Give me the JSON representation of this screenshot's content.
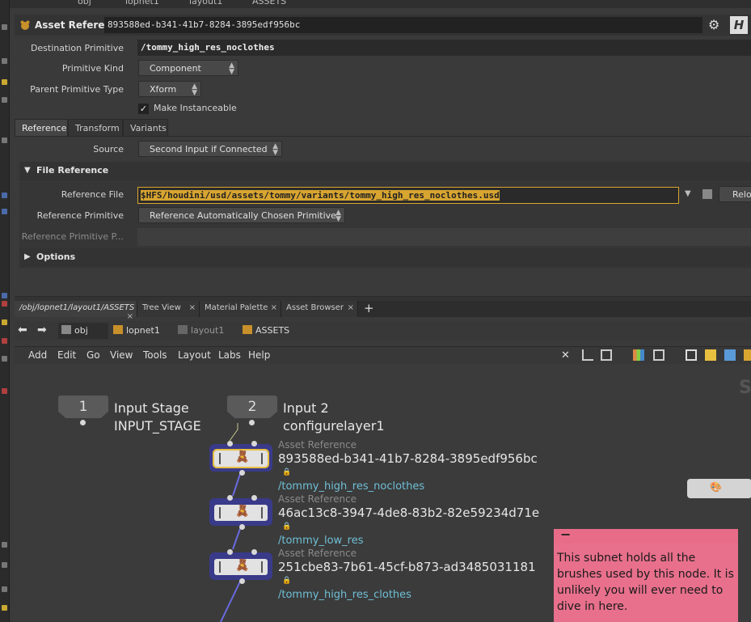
{
  "top_breadcrumb": [
    "obj",
    "lopnet1",
    "layout1",
    "ASSETS"
  ],
  "header": {
    "type_label": "Asset Reference",
    "node_name": "893588ed-b341-41b7-8284-3895edf956bc",
    "help_label": "H"
  },
  "params": {
    "destination_primitive": {
      "label": "Destination Primitive",
      "value": "/tommy_high_res_noclothes"
    },
    "primitive_kind": {
      "label": "Primitive Kind",
      "value": "Component"
    },
    "parent_primitive_type": {
      "label": "Parent Primitive Type",
      "value": "Xform"
    },
    "make_instanceable": {
      "label": "Make Instanceable",
      "checked": true
    }
  },
  "tabs": [
    "Reference",
    "Transform",
    "Variants"
  ],
  "source": {
    "label": "Source",
    "value": "Second Input if Connected"
  },
  "file_reference": {
    "title": "File Reference",
    "reference_file": {
      "label": "Reference File",
      "value": "$HFS/houdini/usd/assets/tommy/variants/tommy_high_res_noclothes.usd",
      "reload": "Relo"
    },
    "reference_primitive": {
      "label": "Reference Primitive",
      "value": "Reference Automatically Chosen Primitive"
    },
    "reference_primitive_path": {
      "label": "Reference Primitive P..."
    }
  },
  "options": {
    "title": "Options"
  },
  "pane_tabs": [
    {
      "label": "/obj/lopnet1/layout1/ASSETS"
    },
    {
      "label": "Tree View"
    },
    {
      "label": "Material Palette"
    },
    {
      "label": "Asset Browser"
    }
  ],
  "nav_crumbs": [
    "obj",
    "lopnet1",
    "layout1",
    "ASSETS"
  ],
  "menu": [
    "Add",
    "Edit",
    "Go",
    "View",
    "Tools",
    "Layout",
    "Labs",
    "Help"
  ],
  "network": {
    "input1": {
      "number": "1",
      "name": "Input Stage",
      "sub": "INPUT_STAGE"
    },
    "input2": {
      "number": "2",
      "name": "Input 2",
      "sub": "configurelayer1"
    },
    "nodes": [
      {
        "type": "Asset Reference",
        "name": "893588ed-b341-41b7-8284-3895edf956bc",
        "path": "/tommy_high_res_noclothes"
      },
      {
        "type": "Asset Reference",
        "name": "46ac13c8-3947-4de8-83b2-82e59234d71e",
        "path": "/tommy_low_res"
      },
      {
        "type": "Asset Reference",
        "name": "251cbe83-7b61-45cf-b873-ad3485031181",
        "path": "/tommy_high_res_clothes"
      }
    ],
    "sticky_note": "This subnet holds all the brushes used by this node. It is unlikely you will ever need to dive in here.",
    "sticky_header": "−",
    "corner_letter": "S"
  },
  "colors": {
    "accent": "#d8a530",
    "node_bg": "#3a3a8a",
    "path_text": "#6fbfd6",
    "sticky": "#e8708c"
  }
}
